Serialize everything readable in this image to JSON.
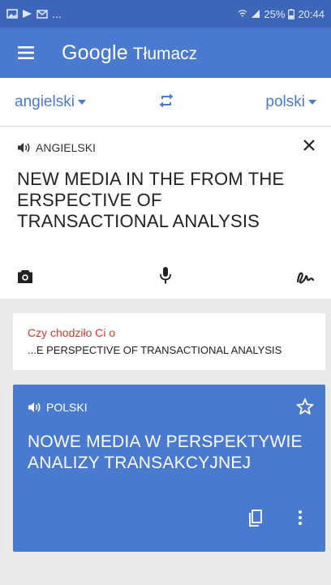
{
  "status_bar": {
    "battery": "25%",
    "time": "20:44"
  },
  "app_bar": {
    "brand": "Google",
    "product": "Tłumacz"
  },
  "languages": {
    "source": "angielski",
    "target": "polski"
  },
  "input": {
    "language_label": "ANGIELSKI",
    "text": "NEW MEDIA IN THE FROM THE ERSPECTIVE OF TRANSACTIONAL ANALYSIS"
  },
  "suggestion": {
    "label": "Czy chodziło Ci o",
    "text": "...E PERSPECTIVE OF TRANSACTIONAL ANALYSIS"
  },
  "result": {
    "language_label": "POLSKI",
    "text": "NOWE MEDIA W PERSPEKTYWIE ANALIZY TRANSAKCYJNEJ"
  },
  "colors": {
    "primary": "#4a7ad0",
    "status": "#3d66b8",
    "suggestion_label": "#d23a2a"
  }
}
